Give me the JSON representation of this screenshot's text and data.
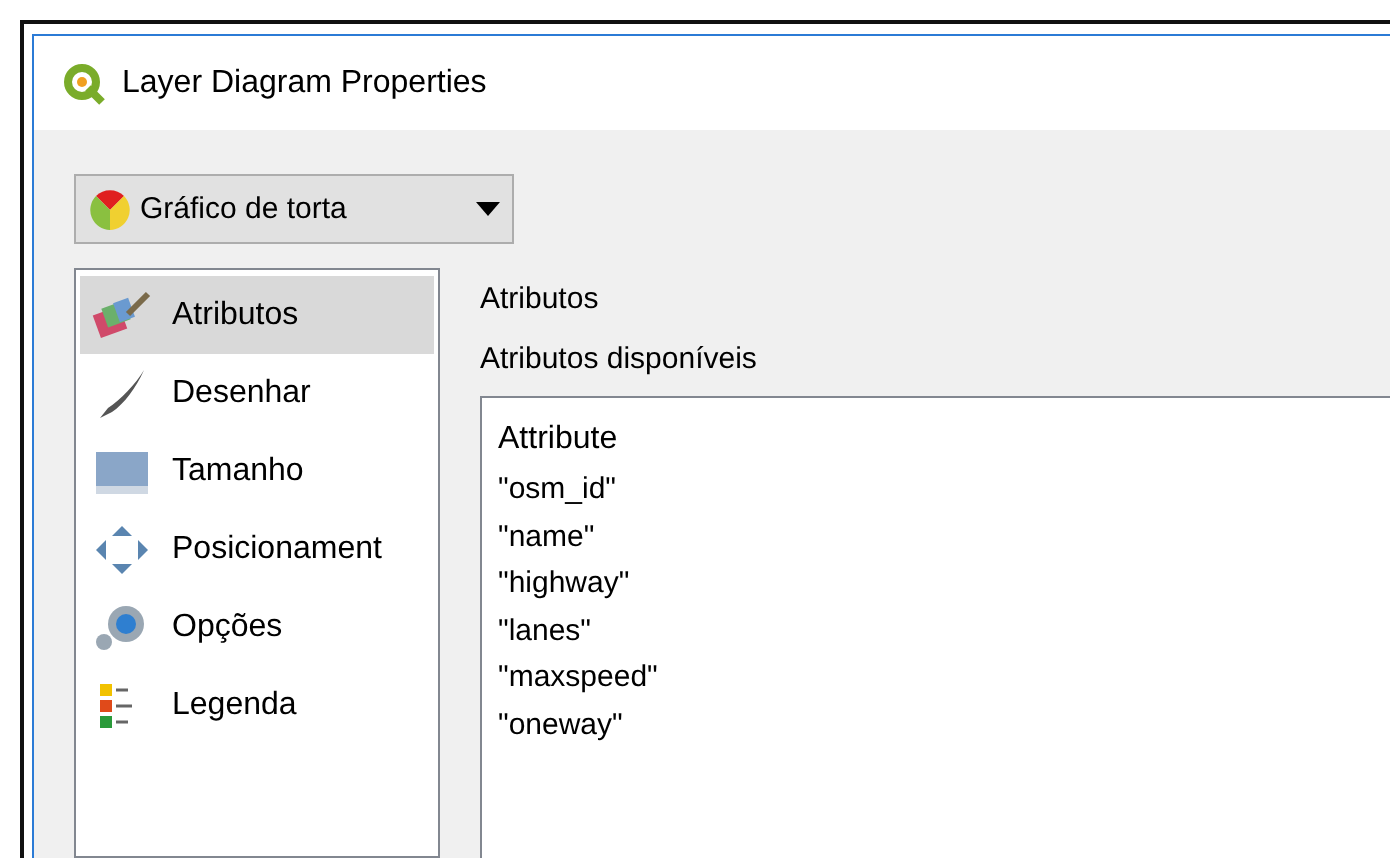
{
  "window": {
    "title": "Layer Diagram Properties"
  },
  "diagram_type": {
    "value": "Gráfico de torta"
  },
  "sidebar": {
    "items": [
      {
        "label": "Atributos",
        "selected": true
      },
      {
        "label": "Desenhar",
        "selected": false
      },
      {
        "label": "Tamanho",
        "selected": false
      },
      {
        "label": "Posicionament",
        "selected": false
      },
      {
        "label": "Opções",
        "selected": false
      },
      {
        "label": "Legenda",
        "selected": false
      }
    ]
  },
  "panel": {
    "title": "Atributos",
    "subtitle": "Atributos disponíveis",
    "table": {
      "columns": [
        "Attribute"
      ],
      "rows": [
        "\"osm_id\"",
        "\"name\"",
        "\"highway\"",
        "\"lanes\"",
        "\"maxspeed\"",
        "\"oneway\""
      ]
    }
  }
}
